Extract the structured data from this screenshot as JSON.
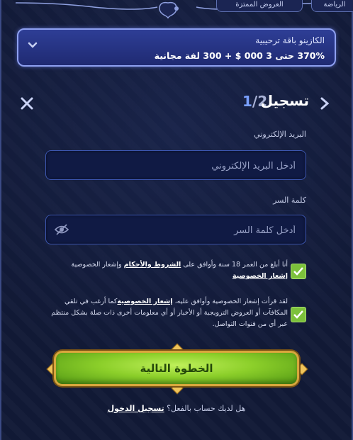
{
  "tabs": {
    "sports": "الرياضة",
    "promotions": "العروض الممتزة"
  },
  "promo": {
    "title": "الكازينو باقة ترحيبية",
    "offer": "370% حتى 3 000 $ + 300 لفة مجانية"
  },
  "header": {
    "title": "تسجيل",
    "step_current": "1",
    "step_total": "/2"
  },
  "form": {
    "email_label": "البريد الإلكتروني",
    "email_placeholder": "أدخل البريد الإلكتروني",
    "password_label": "كلمة السر",
    "password_placeholder": "أدخل كلمة السر"
  },
  "consents": {
    "age_text_1": "أنا أبلغ من العمر 18 سنة وأوافق على",
    "age_terms_link": "الشروط والأحكام",
    "age_text_2": "وإشعار الخصوصية",
    "age_privacy_link": "إشعار الخصوصية",
    "marketing_text_1": "لقد قرأت إشعار الخصوصية وأوافق عليه،",
    "marketing_privacy_link": "إشعار الخصوصية",
    "marketing_text_2": "كما أرغب في تلقي المكافآت أو العروض الترويجية أو الأخبار أو أي معلومات أخرى ذات صلة بشكل منتظم عبر أي من قنوات التواصل."
  },
  "actions": {
    "next_label": "الخطوة التالية",
    "login_prompt": "هل لديك حساب بالفعل؟",
    "login_link": "تسجيل الدخول"
  },
  "colors": {
    "background": "#111936",
    "accent_blue": "#3c56b0",
    "check_green": "#7cc13b",
    "button_green": "#8ccf2a",
    "gold": "#d8a73c"
  },
  "icons": [
    "chevron-down-icon",
    "close-icon",
    "chevron-right-icon",
    "eye-off-icon",
    "check-icon"
  ]
}
